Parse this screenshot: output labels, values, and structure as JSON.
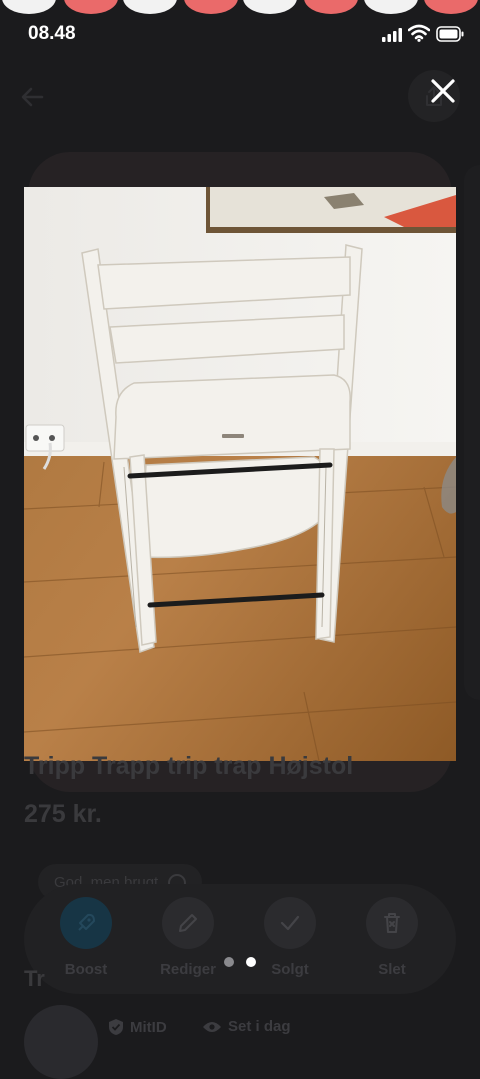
{
  "status_bar": {
    "time": "08.48"
  },
  "listing": {
    "title": "Tripp Trapp trip trap Højstol",
    "price": "275 kr.",
    "condition": "God, men brugt"
  },
  "actions": [
    {
      "label": "Boost",
      "icon": "rocket-icon"
    },
    {
      "label": "Rediger",
      "icon": "pencil-icon"
    },
    {
      "label": "Solgt",
      "icon": "check-icon"
    },
    {
      "label": "Slet",
      "icon": "trash-icon"
    }
  ],
  "gallery": {
    "current_page": 2,
    "total_pages": 2
  },
  "seller": {
    "section_title": "Tr",
    "mitid_label": "MitID",
    "seen_label": "Set i dag"
  },
  "colors": {
    "overlay_bg": "#1b1b1d",
    "accent_dot": "#ea6a6a",
    "active_indicator": "#ffffff",
    "inactive_indicator": "#8a8a8e"
  }
}
